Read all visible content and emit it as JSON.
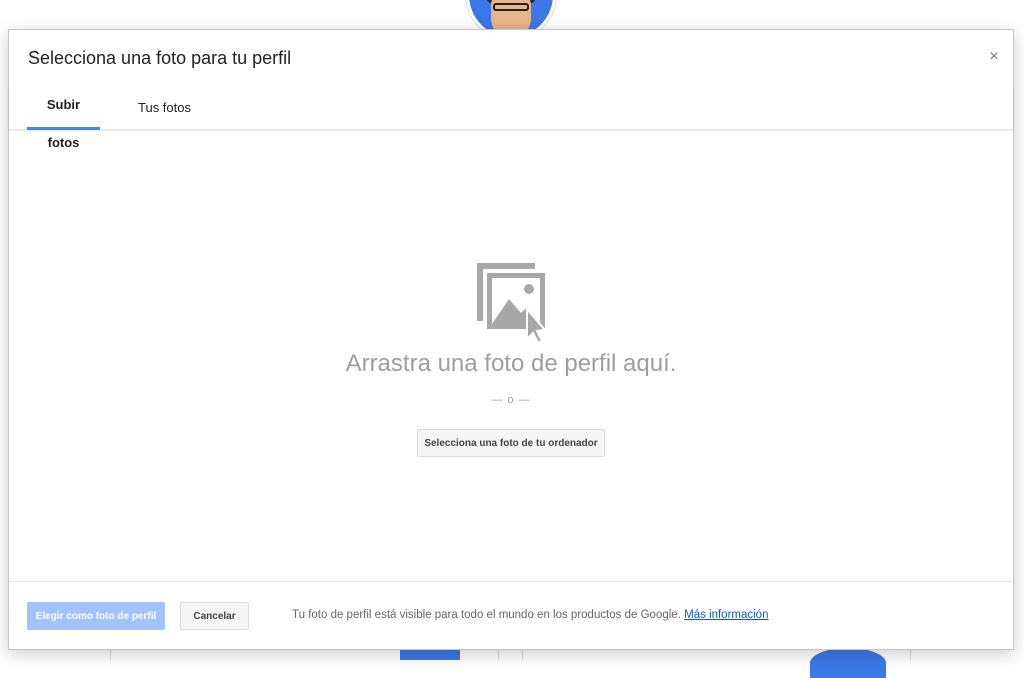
{
  "dialog": {
    "title": "Selecciona una foto para tu perfil",
    "close_label": "×"
  },
  "tabs": [
    {
      "label": "Subir fotos",
      "active": true
    },
    {
      "label": "Tus fotos",
      "active": false
    }
  ],
  "dropzone": {
    "icon": "photo-upload-icon",
    "text": "Arrastra una foto de perfil aquí.",
    "or_text": "— o —",
    "select_button": "Selecciona una foto de tu ordenador"
  },
  "footer": {
    "primary_button": "Elegir como foto de perfil",
    "cancel_button": "Cancelar",
    "note": "Tu foto de perfil está visible para todo el mundo en los productos de Google.",
    "more_info_link": "Más información"
  },
  "colors": {
    "accent": "#4285f4",
    "primary_disabled": "#a1c2fa",
    "link": "#1155cc",
    "muted_text": "#9e9e9e"
  }
}
